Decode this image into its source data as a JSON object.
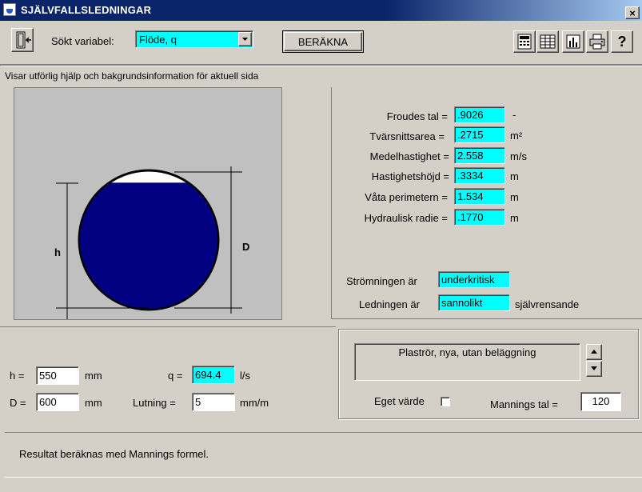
{
  "window": {
    "title": "SJÄLVFALLSLEDNINGAR",
    "close_glyph": "×",
    "background_snippet": "... ... ... ..."
  },
  "toolbar": {
    "variable_label": "Sökt variabel:",
    "variable_value": "Flöde, q",
    "calculate_label": "BERÄKNA",
    "exit_icon": "door-exit-icon",
    "tools": [
      "calculator-icon",
      "table-icon",
      "bar-chart-icon",
      "printer-icon",
      "help-icon"
    ],
    "help_glyph": "?"
  },
  "status_hint": "Visar utförlig hjälp och bakgrundsinformation för aktuell sida",
  "diagram": {
    "h_label": "h",
    "d_label": "D",
    "fill_ratio": 0.9167,
    "colors": {
      "water": "#000080",
      "pipe_bg": "#c0c0c0"
    }
  },
  "results": {
    "rows": [
      {
        "label": "Froudes tal =",
        "value": ".9026",
        "unit": "-"
      },
      {
        "label": "Tvärsnittsarea =",
        "value": ".2715",
        "unit": "m²"
      },
      {
        "label": "Medelhastighet =",
        "value": "2.558",
        "unit": "m/s"
      },
      {
        "label": "Hastighetshöjd =",
        "value": ".3334",
        "unit": "m"
      },
      {
        "label": "Våta perimetern =",
        "value": "1.534",
        "unit": "m"
      },
      {
        "label": "Hydraulisk radie =",
        "value": ".1770",
        "unit": "m"
      }
    ],
    "flow_label": "Strömningen är",
    "flow_value": "underkritisk",
    "pipe_label": "Ledningen är",
    "pipe_value": "sannolikt",
    "pipe_suffix": "självrensande"
  },
  "inputs": {
    "h_label": "h  =",
    "h_value": "550",
    "h_unit": "mm",
    "d_label": "D =",
    "d_value": "600",
    "d_unit": "mm",
    "q_label": "q  =",
    "q_value": "694.4",
    "q_unit": "l/s",
    "slope_label": "Lutning =",
    "slope_value": "5",
    "slope_unit": "mm/m"
  },
  "material": {
    "selected": "Plaströr, nya, utan beläggning",
    "own_value_label": "Eget värde",
    "own_value_checked": false,
    "manning_label": "Mannings tal =",
    "manning_value": "120"
  },
  "footer": {
    "message": "Resultat beräknas med Mannings formel."
  }
}
